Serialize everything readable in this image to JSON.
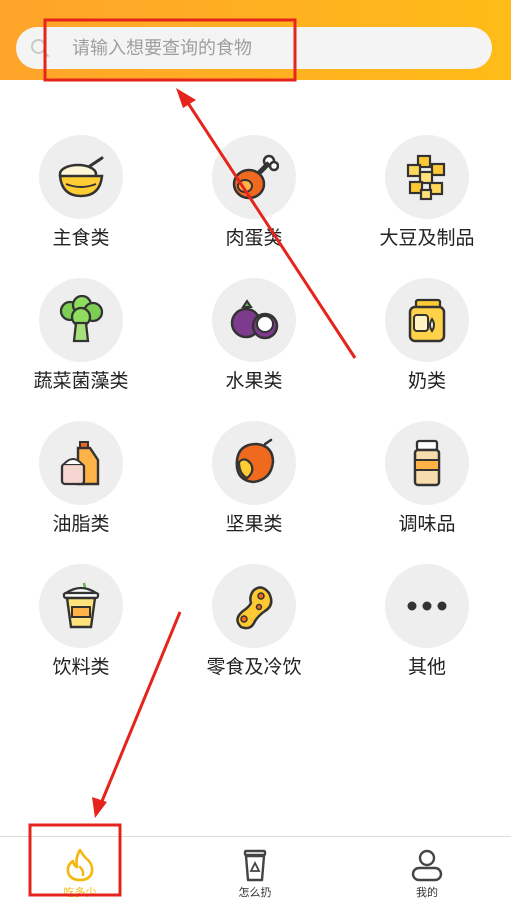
{
  "search": {
    "placeholder": "请输入想要查询的食物",
    "icon": "search-icon"
  },
  "header": {
    "gradient_start": "#ffa42b",
    "gradient_end": "#ffbc17"
  },
  "categories": [
    {
      "label": "主食类",
      "icon": "rice-bowl-icon"
    },
    {
      "label": "肉蛋类",
      "icon": "drumstick-icon"
    },
    {
      "label": "大豆及制品",
      "icon": "tofu-icon"
    },
    {
      "label": "蔬菜菌藻类",
      "icon": "broccoli-icon"
    },
    {
      "label": "水果类",
      "icon": "mangosteen-icon"
    },
    {
      "label": "奶类",
      "icon": "milk-jar-icon"
    },
    {
      "label": "油脂类",
      "icon": "oil-bottle-icon"
    },
    {
      "label": "坚果类",
      "icon": "chestnut-icon"
    },
    {
      "label": "调味品",
      "icon": "seasoning-icon"
    },
    {
      "label": "饮料类",
      "icon": "drink-cup-icon"
    },
    {
      "label": "零食及冷饮",
      "icon": "peanut-icon"
    },
    {
      "label": "其他",
      "icon": "more-dots-icon"
    }
  ],
  "tabbar": {
    "tabs": [
      {
        "label": "吃多少",
        "icon": "flame-icon",
        "active": true
      },
      {
        "label": "怎么扔",
        "icon": "recycle-bin-icon",
        "active": false
      },
      {
        "label": "我的",
        "icon": "user-icon",
        "active": false
      }
    ],
    "active_color": "#f5b70d"
  },
  "annotation_color": "#e5251c"
}
